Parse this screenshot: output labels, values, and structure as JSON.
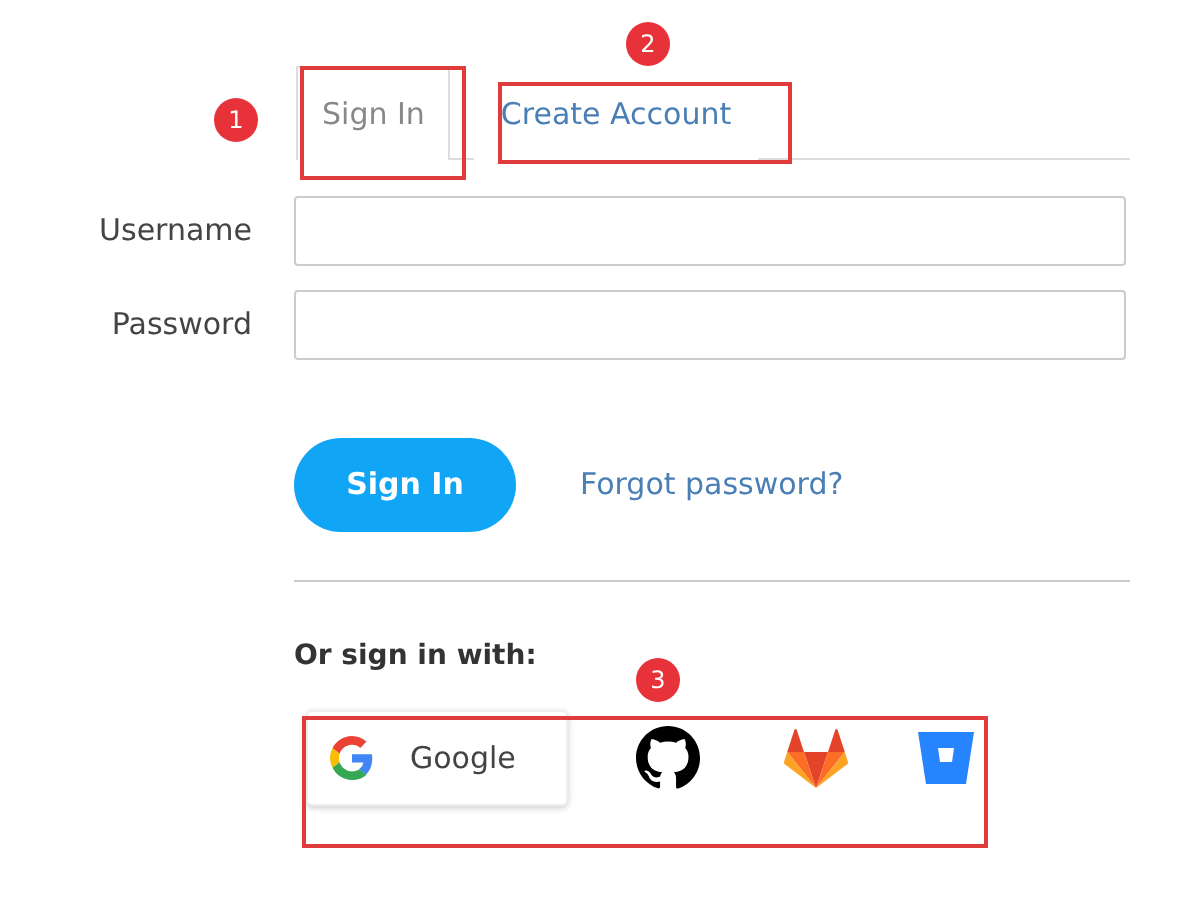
{
  "tabs": [
    {
      "label": "Sign In",
      "selected": true
    },
    {
      "label": "Create Account",
      "selected": false
    }
  ],
  "fields": [
    {
      "label": "Username"
    },
    {
      "label": "Password"
    }
  ],
  "submit": "Sign In",
  "forgot_link": "Forgot password?",
  "social_heading": "Or sign in with:",
  "social": [
    {
      "kind": "google",
      "label": "Google"
    },
    {
      "kind": "github"
    },
    {
      "kind": "gitlab"
    },
    {
      "kind": "bitbucket"
    }
  ],
  "callouts": [
    {
      "number": "1"
    },
    {
      "number": "2"
    },
    {
      "number": "3"
    }
  ]
}
